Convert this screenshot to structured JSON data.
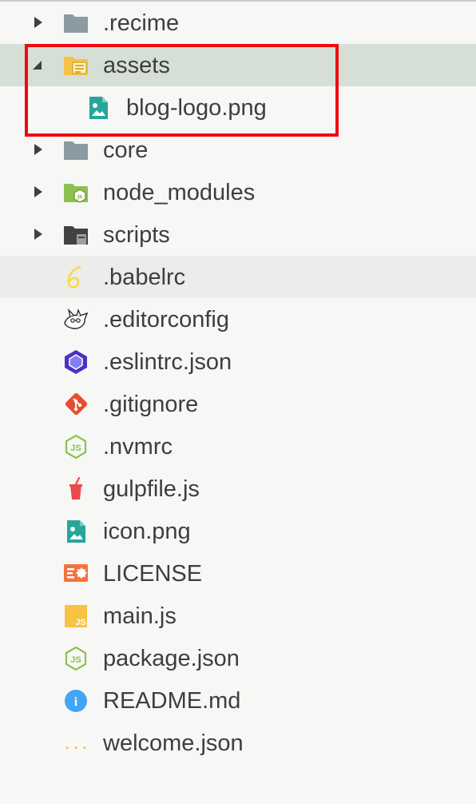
{
  "colors": {
    "background": "#f7f7f5",
    "selected_row": "#d6dfd6",
    "highlight_box": "#ee0a10",
    "folder_gray": "#8c9aa3",
    "folder_yellow": "#f6c24a",
    "node_green": "#8cc152",
    "image_teal": "#26a69a",
    "babel_yellow": "#f5da55",
    "eslint_blue": "#4b32c3",
    "git_orange": "#e84d31",
    "gulp_red": "#eb4a4b",
    "license_orange": "#f4733b",
    "js_yellow": "#f6c343",
    "info_blue": "#42a5f5"
  },
  "tree": {
    "items": [
      {
        "label": ".recime",
        "icon": "folder-gray-icon",
        "kind": "folder",
        "expanded": false
      },
      {
        "label": "assets",
        "icon": "folder-open-yellow-icon",
        "kind": "folder",
        "expanded": true,
        "selected": true
      },
      {
        "label": "blog-logo.png",
        "icon": "image-file-icon",
        "kind": "file",
        "level": 1
      },
      {
        "label": "core",
        "icon": "folder-gray-icon",
        "kind": "folder",
        "expanded": false
      },
      {
        "label": "node_modules",
        "icon": "folder-node-icon",
        "kind": "folder",
        "expanded": false
      },
      {
        "label": "scripts",
        "icon": "folder-scripts-icon",
        "kind": "folder",
        "expanded": false
      },
      {
        "label": ".babelrc",
        "icon": "babel-icon",
        "kind": "file"
      },
      {
        "label": ".editorconfig",
        "icon": "editorconfig-mouse-icon",
        "kind": "file"
      },
      {
        "label": ".eslintrc.json",
        "icon": "eslint-icon",
        "kind": "file"
      },
      {
        "label": ".gitignore",
        "icon": "git-icon",
        "kind": "file"
      },
      {
        "label": ".nvmrc",
        "icon": "nodejs-hexagon-icon",
        "kind": "file"
      },
      {
        "label": "gulpfile.js",
        "icon": "gulp-cup-icon",
        "kind": "file"
      },
      {
        "label": "icon.png",
        "icon": "image-file-icon",
        "kind": "file"
      },
      {
        "label": "LICENSE",
        "icon": "license-icon",
        "kind": "file"
      },
      {
        "label": "main.js",
        "icon": "javascript-icon",
        "kind": "file"
      },
      {
        "label": "package.json",
        "icon": "nodejs-hexagon-icon",
        "kind": "file"
      },
      {
        "label": "README.md",
        "icon": "info-icon",
        "kind": "file"
      },
      {
        "label": "welcome.json",
        "icon": "json-braces-icon",
        "kind": "file"
      }
    ],
    "js_badge": "JS",
    "json_badge": "{...}",
    "info_badge": "i"
  }
}
